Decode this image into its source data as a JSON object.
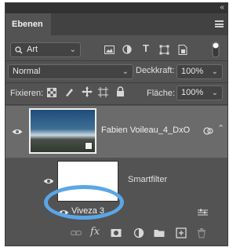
{
  "window": {
    "collapse_glyph": "«",
    "close_glyph": "×"
  },
  "tab": {
    "label": "Ebenen"
  },
  "filter": {
    "label": "Art",
    "icons": [
      "image-filter-icon",
      "adjustment-filter-icon",
      "type-filter-icon",
      "shape-filter-icon",
      "smart-object-filter-icon",
      "filter-toggle-icon"
    ]
  },
  "blend": {
    "mode": "Normal",
    "opacity_label": "Deckkraft:",
    "opacity_value": "100%"
  },
  "lock": {
    "label": "Fixieren:",
    "fill_label": "Fläche:",
    "fill_value": "100%"
  },
  "layers": [
    {
      "name": "Fabien Voileau_4_DxO",
      "type": "smart-object",
      "visible": true
    },
    {
      "name": "Smartfilter",
      "type": "smart-filter-mask",
      "visible": true
    },
    {
      "name": "Viveza 3",
      "type": "filter",
      "visible": true
    }
  ],
  "bottom_icons": [
    "link-icon",
    "fx-icon",
    "add-mask-icon",
    "adjustment-layer-icon",
    "folder-icon",
    "new-layer-icon",
    "trash-icon"
  ],
  "colors": {
    "panel": "#535353",
    "selected_layer": "#6b6b6b",
    "highlight_ring": "#5aa6e6"
  }
}
